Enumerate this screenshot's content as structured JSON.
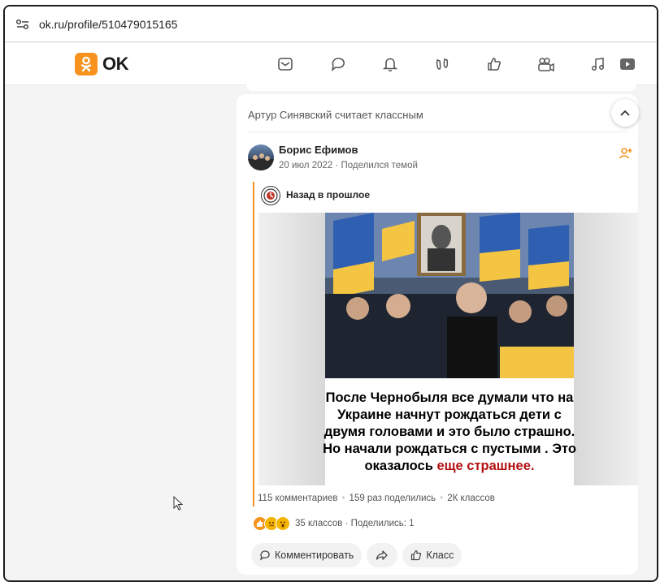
{
  "browser": {
    "url": "ok.ru/profile/510479015165"
  },
  "header": {
    "logo_text": "OK",
    "nav_icons": [
      "messages-icon",
      "discussions-icon",
      "notifications-icon",
      "guests-icon",
      "likes-icon",
      "video-icon",
      "music-icon",
      "tv-icon"
    ]
  },
  "feed": {
    "liked_by_text": "Артур Синявский считает классным",
    "post": {
      "author_name": "Борис Ефимов",
      "meta": "20 июл 2022 · Поделился темой",
      "group_name": "Назад в прошлое",
      "image_caption": [
        "После Чернобыля все думали что на",
        "Украине начнут рождаться дети с",
        "двумя головами и это было страшно.",
        "Но начали рождаться с пустыми . Это"
      ],
      "image_caption_last_plain": "оказалось ",
      "image_caption_last_red": "еще страшнее.",
      "stats": {
        "comments": "115 комментариев",
        "shares": "159 раз поделились",
        "likes": "2К классов"
      },
      "reactions_text": "35 классов · Поделились: 1",
      "actions": {
        "comment_label": "Комментировать",
        "class_label": "Класс"
      }
    }
  },
  "colors": {
    "brand_orange": "#f7931e",
    "caption_red": "#b31010"
  }
}
